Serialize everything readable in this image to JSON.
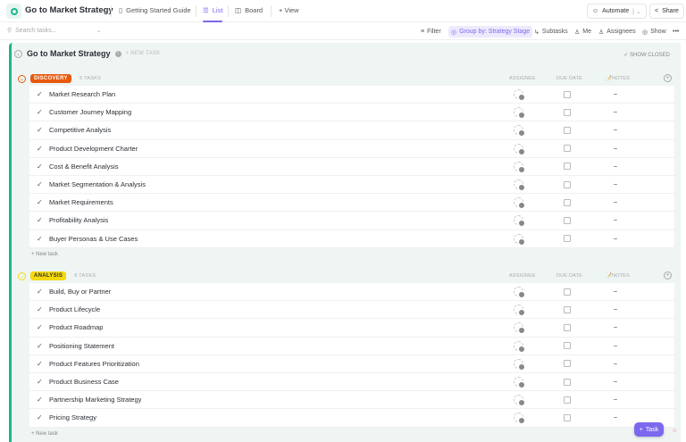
{
  "header": {
    "title": "Go to Market Strategy",
    "tabs": [
      {
        "label": "Getting Started Guide"
      },
      {
        "label": "List"
      },
      {
        "label": "Board"
      },
      {
        "label": "+ View"
      }
    ],
    "automate": "Automate",
    "share": "Share"
  },
  "toolbar": {
    "search_placeholder": "Search tasks...",
    "filter": "Filter",
    "group_by": "Group by: Strategy Stage",
    "subtasks": "Subtasks",
    "me": "Me",
    "assignees": "Assignees",
    "show": "Show"
  },
  "list": {
    "title": "Go to Market Strategy",
    "new_task": "+ NEW TASK",
    "show_closed": "✓ SHOW CLOSED"
  },
  "columns": {
    "assignee": "ASSIGNEE",
    "due_date": "DUE DATE",
    "notes": "📝NOTES"
  },
  "groups": [
    {
      "name": "DISCOVERY",
      "count": "9 TASKS",
      "color": "#e8590c",
      "text_color": "#ffffff",
      "add": "+ New task",
      "tasks": [
        "Market Research Plan",
        "Customer Journey Mapping",
        "Competitive Analysis",
        "Product Development Charter",
        "Cost & Benefit Analysis",
        "Market Segmentation & Analysis",
        "Market Requirements",
        "Profitability Analysis",
        "Buyer Personas & Use Cases"
      ]
    },
    {
      "name": "ANALYSIS",
      "count": "8 TASKS",
      "color": "#f5d90a",
      "text_color": "#333333",
      "add": "+ New task",
      "tasks": [
        "Build, Buy or Partner",
        "Product Lifecycle",
        "Product Roadmap",
        "Positioning Statement",
        "Product Features Prioritization",
        "Product Business Case",
        "Partnership Marketing Strategy",
        "Pricing Strategy"
      ]
    }
  ],
  "empty_value": "–",
  "fab": {
    "label": "Task"
  }
}
